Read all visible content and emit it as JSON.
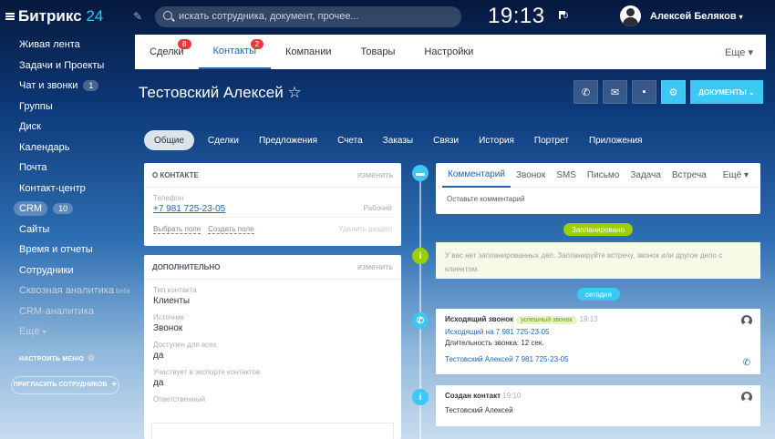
{
  "header": {
    "logo_main": "Битрикс",
    "logo_num": "24",
    "search_placeholder": "искать сотрудника, документ, прочее...",
    "time": "19:13",
    "flag_count": "0",
    "user_name": "Алексей Беляков",
    "user_caret": "▾"
  },
  "sidebar": {
    "items": [
      {
        "label": "Живая лента"
      },
      {
        "label": "Задачи и Проекты"
      },
      {
        "label": "Чат и звонки",
        "count": "1"
      },
      {
        "label": "Группы"
      },
      {
        "label": "Диск"
      },
      {
        "label": "Календарь"
      },
      {
        "label": "Почта"
      },
      {
        "label": "Контакт-центр"
      },
      {
        "label": "CRM",
        "count": "10"
      },
      {
        "label": "Сайты"
      },
      {
        "label": "Время и отчеты"
      },
      {
        "label": "Сотрудники"
      },
      {
        "label": "Сквозная аналитика",
        "sup": "beta"
      },
      {
        "label": "CRM-аналитика"
      },
      {
        "label": "Ещё",
        "caret": "▾"
      }
    ],
    "setup_menu": "НАСТРОИТЬ МЕНЮ",
    "invite": "ПРИГЛАСИТЬ СОТРУДНИКОВ"
  },
  "main_tabs": [
    {
      "label": "Сделки",
      "badge": "8"
    },
    {
      "label": "Контакты",
      "badge": "2"
    },
    {
      "label": "Компании"
    },
    {
      "label": "Товары"
    },
    {
      "label": "Настройки"
    },
    {
      "label": "Еще ▾"
    }
  ],
  "page": {
    "title": "Тестовский Алексей",
    "star": "☆",
    "documents_button": "ДОКУМЕНТЫ"
  },
  "section_tabs": [
    "Общие",
    "Сделки",
    "Предложения",
    "Счета",
    "Заказы",
    "Связи",
    "История",
    "Портрет",
    "Приложения"
  ],
  "about": {
    "heading": "О КОНТАКТЕ",
    "edit": "изменить",
    "phone_label": "Телефон",
    "phone": "+7 981 725-23-05",
    "phone_type": "Рабочий",
    "select_field": "Выбрать поле",
    "create_field": "Создать поле",
    "remove_section": "Удалить раздел"
  },
  "extra": {
    "heading": "ДОПОЛНИТЕЛЬНО",
    "edit": "изменить",
    "fields": [
      {
        "label": "Тип контакта",
        "value": "Клиенты"
      },
      {
        "label": "Источник",
        "value": "Звонок"
      },
      {
        "label": "Доступен для всех",
        "value": "да"
      },
      {
        "label": "Участвует в экспорте контактов",
        "value": "да"
      },
      {
        "label": "Ответственный",
        "value": ""
      }
    ]
  },
  "composer": {
    "tabs": [
      "Комментарий",
      "Звонок",
      "SMS",
      "Письмо",
      "Задача",
      "Встреча",
      "Ещё ▾"
    ],
    "placeholder": "Оставьте комментарий"
  },
  "timeline": {
    "planned_label": "Запланировано",
    "planned_note": "У вас нет запланированных дел. Запланируйте встречу, звонок или другое дело с клиентом.",
    "today_label": "сегодня",
    "call": {
      "title": "Исходящий звонок",
      "status": "успешный звонок",
      "time": "19:13",
      "link": "Исходящий на 7 981 725-23-05",
      "duration": "Длительность звонка: 12 сек.",
      "contact": "Тестовский Алексей 7 981 725-23-05"
    },
    "created": {
      "title": "Создан контакт",
      "time": "19:10",
      "name": "Тестовский Алексей"
    }
  },
  "colors": {
    "accent": "#2067b0",
    "cyan": "#3bc8f5",
    "green": "#9dcf00",
    "badge": "#f0363f"
  }
}
